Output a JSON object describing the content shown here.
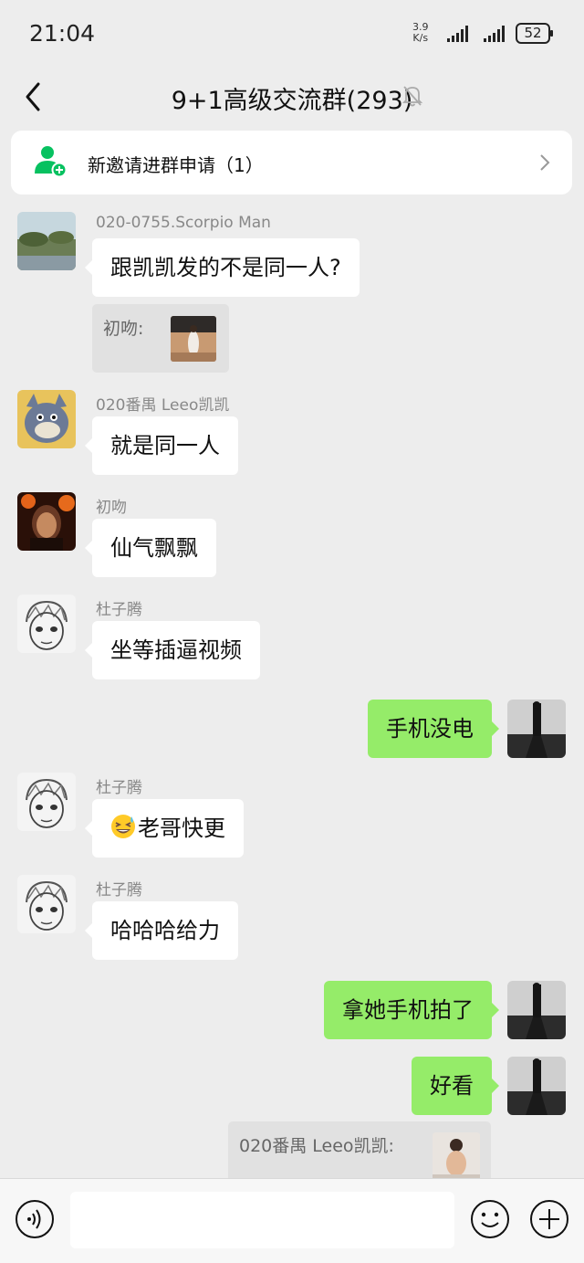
{
  "status_bar": {
    "time": "21:04",
    "net_speed_value": "3.9",
    "net_speed_unit": "K/s",
    "battery": "52"
  },
  "header": {
    "back_icon": "chevron-left-icon",
    "title": "9+1高级交流群(293)",
    "mute_icon": "bell-off-icon"
  },
  "invite": {
    "icon": "add-member-icon",
    "label": "新邀请进群申请（1）",
    "accent": "#07c160"
  },
  "messages": [
    {
      "sender": "020-0755.Scorpio Man",
      "text": "跟凯凯发的不是同一人?",
      "quote_label": "初吻:"
    },
    {
      "sender": "020番禺 Leeo凯凯",
      "text": "就是同一人"
    },
    {
      "sender": "初吻",
      "text": "仙气飘飘"
    },
    {
      "sender": "杜子腾",
      "text": "坐等插逼视频"
    },
    {
      "text": "手机没电"
    },
    {
      "sender": "杜子腾",
      "emoji": "grinning-squint-sweat-emoji",
      "text": "老哥快更"
    },
    {
      "sender": "杜子腾",
      "text": "哈哈哈给力"
    },
    {
      "text": "拿她手机拍了"
    },
    {
      "text": "好看",
      "quote_label": "020番禺 Leeo凯凯:"
    }
  ],
  "input_bar": {
    "voice_icon": "voice-icon",
    "input_value": "",
    "emoji_icon": "emoji-icon",
    "plus_icon": "plus-icon"
  },
  "colors": {
    "background": "#ededed",
    "outgoing_bubble": "#95ec69",
    "incoming_bubble": "#ffffff"
  }
}
